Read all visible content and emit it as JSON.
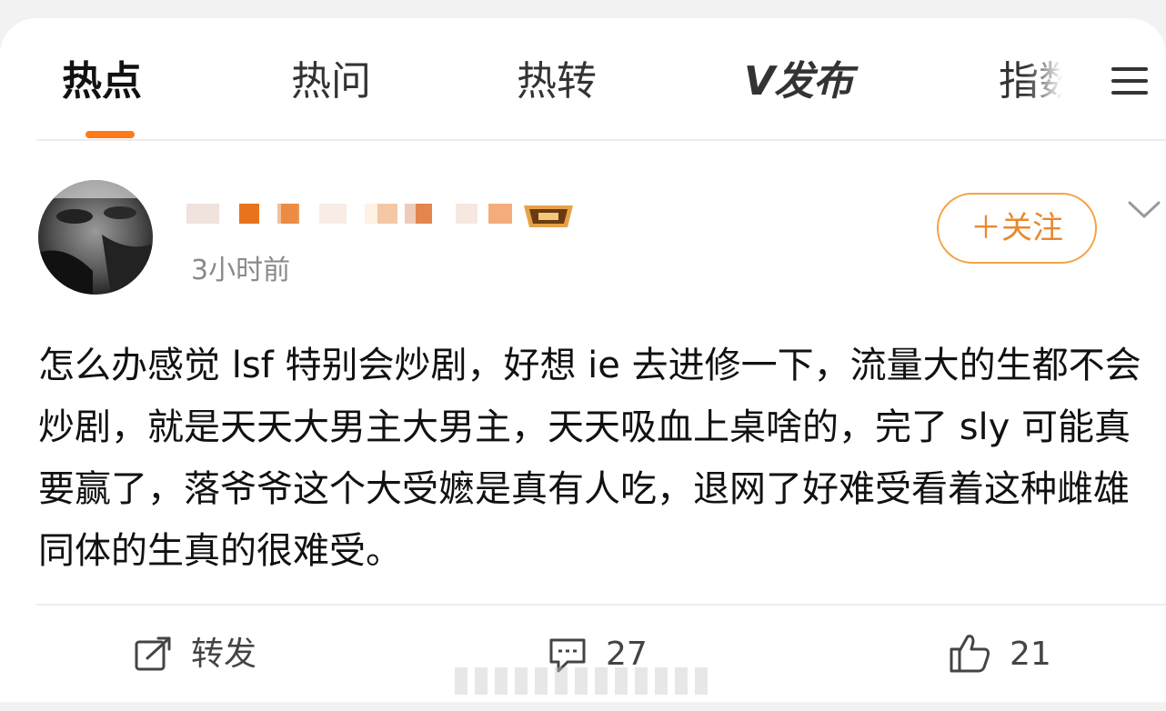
{
  "tabs": [
    {
      "label": "热点",
      "active": true
    },
    {
      "label": "热问",
      "active": false
    },
    {
      "label": "热转",
      "active": false
    },
    {
      "label": "V发布",
      "active": false
    },
    {
      "label": "指数",
      "active": false
    }
  ],
  "post": {
    "time": "3小时前",
    "follow_label": "＋关注",
    "text": "怎么办感觉 lsf 特别会炒剧，好想 ie 去进修一下，流量大的生都不会炒剧，就是天天大男主大男主，天天吸血上桌啥的，完了 sly 可能真要赢了，落爷爷这个大受嬷是真有人吃，退网了好难受看着这种雌雄同体的生真的很难受。"
  },
  "actions": {
    "repost_label": "转发",
    "comment_count": "27",
    "like_count": "21"
  },
  "colors": {
    "accent": "#ff7a1a",
    "follow": "#e8892f",
    "muted": "#8a8a8a"
  },
  "icons": {
    "menu": "hamburger-menu-icon",
    "more": "chevron-down-icon",
    "repost": "share-square-icon",
    "comment": "comment-bubble-icon",
    "like": "thumbs-up-icon"
  }
}
